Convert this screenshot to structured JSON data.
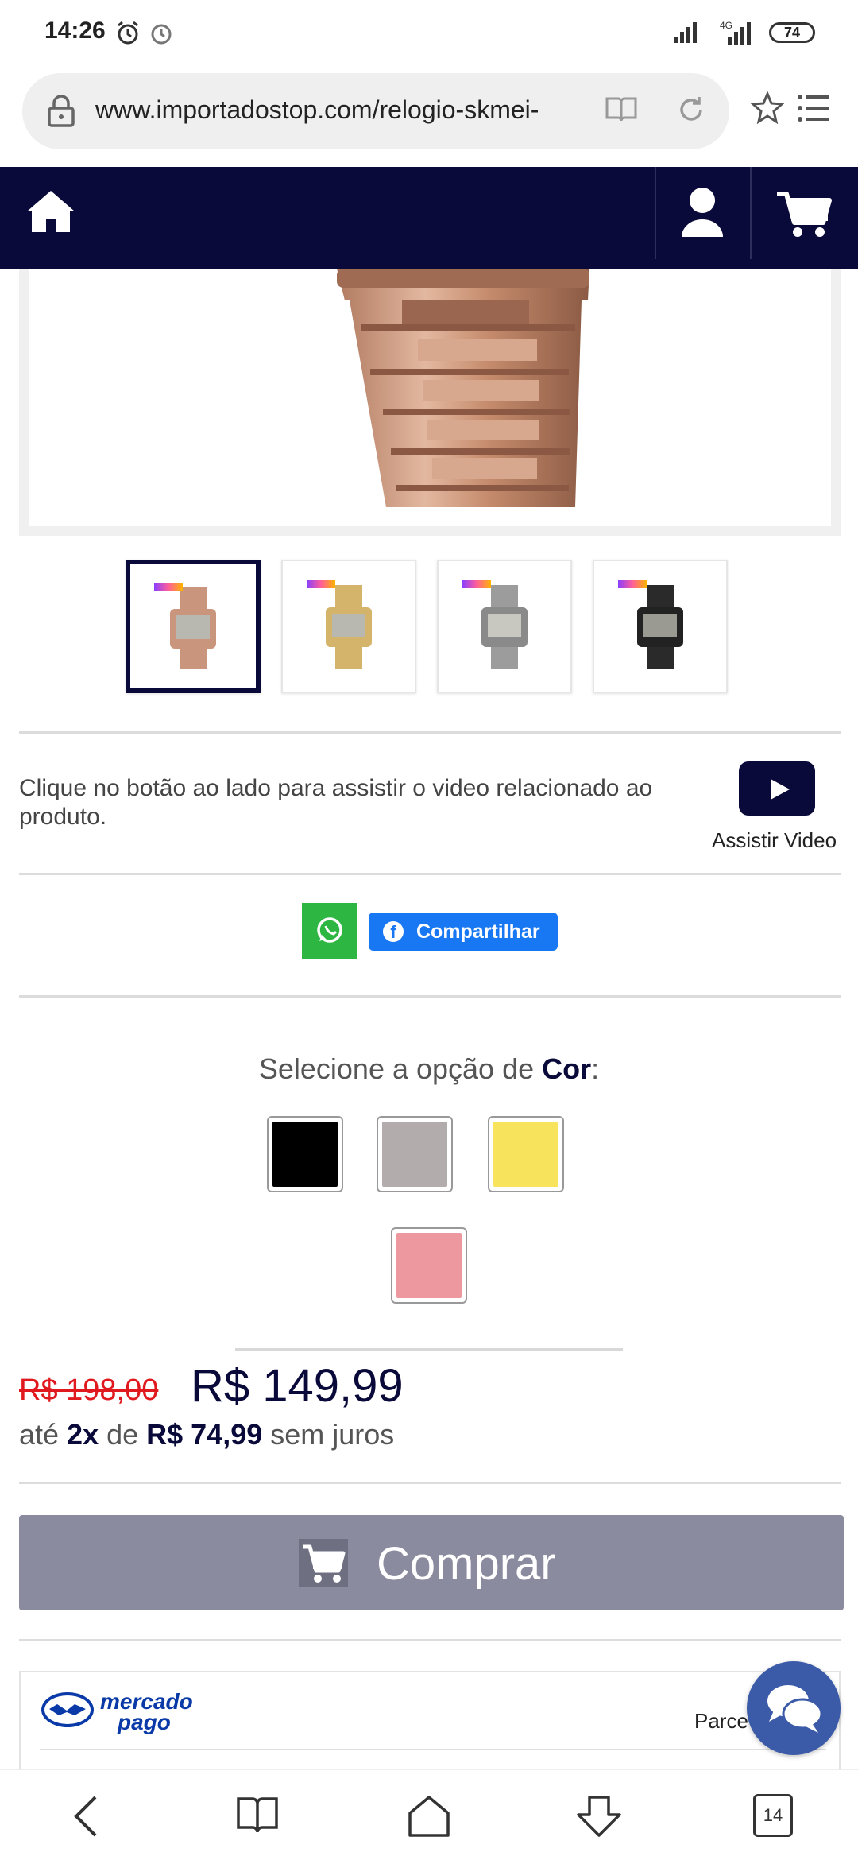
{
  "status_bar": {
    "time": "14:26",
    "network": "4G",
    "battery": "74"
  },
  "browser": {
    "url": "www.importadostop.com/relogio-skmei-"
  },
  "video": {
    "description": "Clique no botão ao lado para assistir o video relacionado ao produto.",
    "button_label": "Assistir Video"
  },
  "share": {
    "facebook_label": "Compartilhar"
  },
  "options": {
    "title_prefix": "Selecione a opção de ",
    "title_option": "Cor",
    "title_suffix": ":",
    "swatches": [
      {
        "name": "black",
        "color": "#000000"
      },
      {
        "name": "grey",
        "color": "#b3acac"
      },
      {
        "name": "yellow",
        "color": "#f8e45c"
      },
      {
        "name": "pink",
        "color": "#ec989e"
      }
    ]
  },
  "pricing": {
    "old_price": "R$ 198,00",
    "new_price": "R$ 149,99",
    "inst_pre": "até ",
    "inst_count": "2x",
    "inst_mid": " de ",
    "inst_value": "R$ 74,99",
    "inst_post": " sem juros"
  },
  "buy": {
    "label": "Comprar"
  },
  "payment": {
    "brand_line1": "mercado",
    "brand_line2": "pago",
    "installments_label": "Parce"
  },
  "tabs": {
    "count": "14"
  },
  "colors": {
    "header_bg": "#0a0a3a",
    "buy_bg": "#8a8b9e",
    "old_price": "#e0191f"
  }
}
